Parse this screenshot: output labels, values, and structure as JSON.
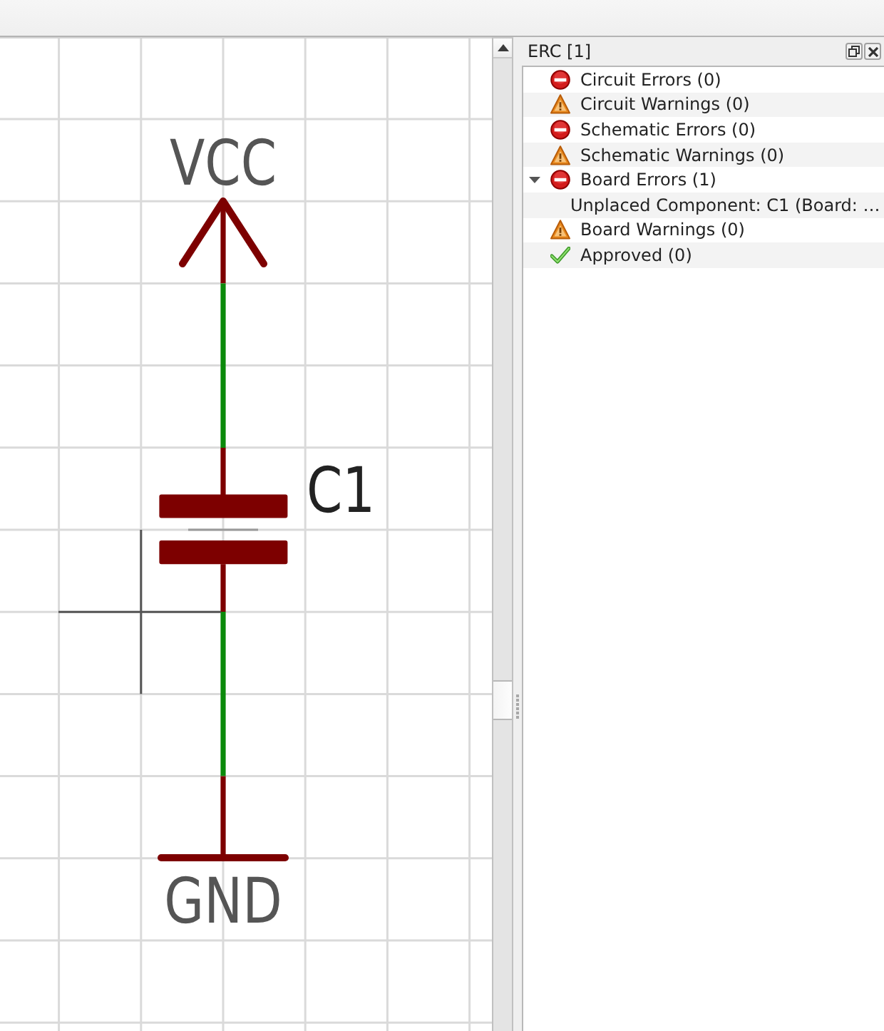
{
  "schematic": {
    "supply_label": "VCC",
    "component_label": "C1",
    "ground_label": "GND"
  },
  "erc_panel": {
    "title": "ERC [1]",
    "items": [
      {
        "kind": "error",
        "label": "Circuit Errors (0)"
      },
      {
        "kind": "warning",
        "label": "Circuit Warnings (0)"
      },
      {
        "kind": "error",
        "label": "Schematic Errors (0)"
      },
      {
        "kind": "warning",
        "label": "Schematic Warnings (0)"
      },
      {
        "kind": "error",
        "label": "Board Errors (1)",
        "expanded": true,
        "children": [
          {
            "label": "Unplaced Component: C1 (Board: …"
          }
        ]
      },
      {
        "kind": "warning",
        "label": "Board Warnings (0)"
      },
      {
        "kind": "approved",
        "label": "Approved (0)"
      }
    ]
  }
}
